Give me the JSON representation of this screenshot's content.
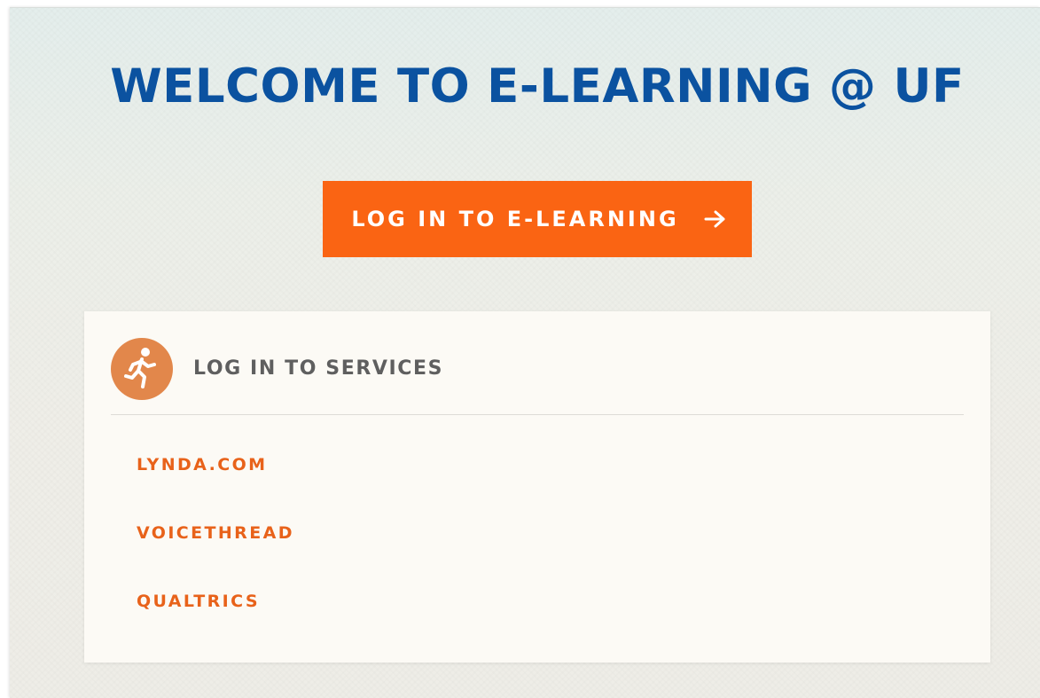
{
  "page": {
    "title": "WELCOME TO E-LEARNING @ UF"
  },
  "login_button": {
    "label": "LOG IN TO E-LEARNING",
    "icon": "arrow-right-icon"
  },
  "services": {
    "heading": "LOG IN TO SERVICES",
    "icon": "running-person-icon",
    "links": [
      {
        "label": "LYNDA.COM"
      },
      {
        "label": "VOICETHREAD"
      },
      {
        "label": "QUALTRICS"
      }
    ]
  },
  "colors": {
    "title_blue": "#0b52a0",
    "accent_orange": "#fa6413",
    "link_orange": "#e8621a",
    "icon_orange": "#e2874b",
    "heading_gray": "#5f5f5f",
    "card_background": "#fcfaf5"
  }
}
